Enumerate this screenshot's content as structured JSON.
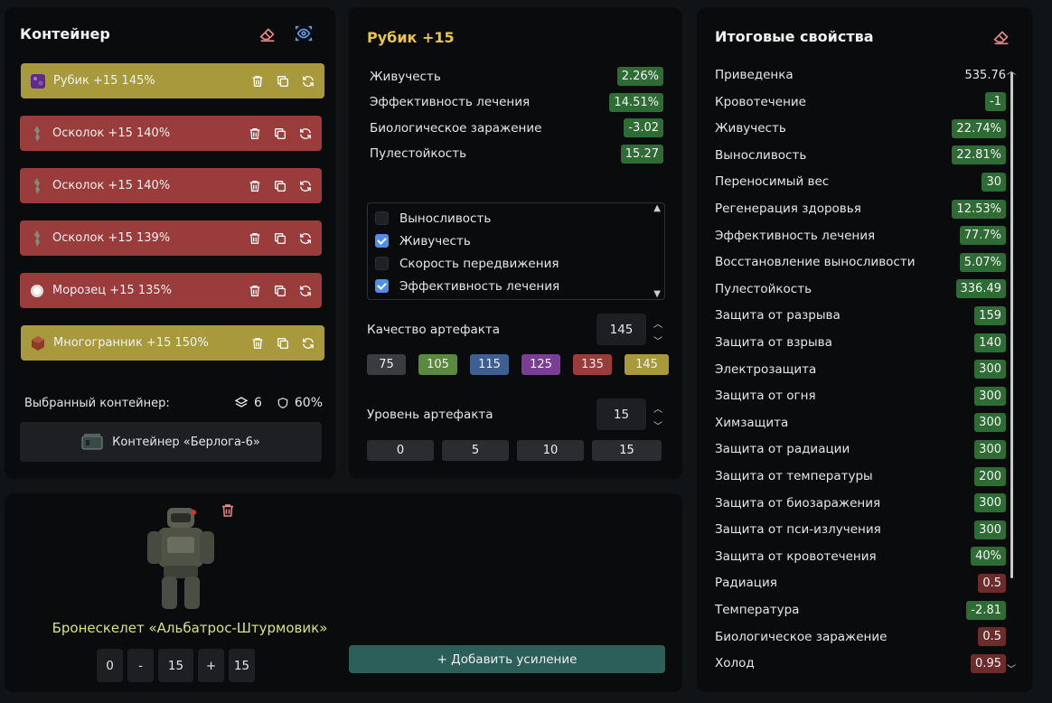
{
  "container_panel": {
    "title": "Контейнер",
    "items": [
      {
        "label": "Рубик +15 145%",
        "color": "gold",
        "icon": "rubik-artifact-icon",
        "third_icon": "refresh-icon"
      },
      {
        "label": "Осколок +15 140%",
        "color": "red",
        "icon": "shard-artifact-icon"
      },
      {
        "label": "Осколок +15 140%",
        "color": "red",
        "icon": "shard-artifact-icon"
      },
      {
        "label": "Осколок +15 139%",
        "color": "red",
        "icon": "shard-artifact-icon"
      },
      {
        "label": "Морозец +15 135%",
        "color": "red",
        "icon": "frost-artifact-icon"
      },
      {
        "label": "Многогранник +15 150%",
        "color": "gold",
        "icon": "polyhedron-artifact-icon"
      }
    ],
    "selected_label": "Выбранный контейнер:",
    "slots": "6",
    "protection": "60%",
    "container_name": "Контейнер «Берлога-6»"
  },
  "artifact_panel": {
    "title": "Рубик +15",
    "stats": [
      {
        "name": "Живучесть",
        "value": "2.26%",
        "tone": "g"
      },
      {
        "name": "Эффективность лечения",
        "value": "14.51%",
        "tone": "g"
      },
      {
        "name": "Биологическое заражение",
        "value": "-3.02",
        "tone": "g"
      },
      {
        "name": "Пулестойкость",
        "value": "15.27",
        "tone": "g"
      }
    ],
    "checklist": [
      {
        "label": "Выносливость",
        "checked": false
      },
      {
        "label": "Живучесть",
        "checked": true
      },
      {
        "label": "Скорость передвижения",
        "checked": false
      },
      {
        "label": "Эффективность лечения",
        "checked": true
      }
    ],
    "quality_label": "Качество артефакта",
    "quality_value": "145",
    "quality_options": [
      {
        "label": "75",
        "color": "#3a3c40"
      },
      {
        "label": "105",
        "color": "#5a8a3e"
      },
      {
        "label": "115",
        "color": "#3f5f92"
      },
      {
        "label": "125",
        "color": "#7a3e94"
      },
      {
        "label": "135",
        "color": "#9a3b3c"
      },
      {
        "label": "145",
        "color": "#a89a3c"
      }
    ],
    "level_label": "Уровень артефакта",
    "level_value": "15",
    "level_options": [
      "0",
      "5",
      "10",
      "15"
    ]
  },
  "total_panel": {
    "title": "Итоговые свойства",
    "rows": [
      {
        "name": "Приведенка",
        "value": "535.76",
        "tone": "none"
      },
      {
        "name": "Кровотечение",
        "value": "-1",
        "tone": "g"
      },
      {
        "name": "Живучесть",
        "value": "22.74%",
        "tone": "g"
      },
      {
        "name": "Выносливость",
        "value": "22.81%",
        "tone": "g"
      },
      {
        "name": "Переносимый вес",
        "value": "30",
        "tone": "g"
      },
      {
        "name": "Регенерация здоровья",
        "value": "12.53%",
        "tone": "g"
      },
      {
        "name": "Эффективность лечения",
        "value": "77.7%",
        "tone": "g"
      },
      {
        "name": "Восстановление выносливости",
        "value": "5.07%",
        "tone": "g"
      },
      {
        "name": "Пулестойкость",
        "value": "336.49",
        "tone": "g"
      },
      {
        "name": "Защита от разрыва",
        "value": "159",
        "tone": "g"
      },
      {
        "name": "Защита от взрыва",
        "value": "140",
        "tone": "g"
      },
      {
        "name": "Электрозащита",
        "value": "300",
        "tone": "g"
      },
      {
        "name": "Защита от огня",
        "value": "300",
        "tone": "g"
      },
      {
        "name": "Химзащита",
        "value": "300",
        "tone": "g"
      },
      {
        "name": "Защита от радиации",
        "value": "300",
        "tone": "g"
      },
      {
        "name": "Защита от температуры",
        "value": "200",
        "tone": "g"
      },
      {
        "name": "Защита от биозаражения",
        "value": "300",
        "tone": "g"
      },
      {
        "name": "Защита от пси-излучения",
        "value": "300",
        "tone": "g"
      },
      {
        "name": "Защита от кровотечения",
        "value": "40%",
        "tone": "g"
      },
      {
        "name": "Радиация",
        "value": "0.5",
        "tone": "r"
      },
      {
        "name": "Температура",
        "value": "-2.81",
        "tone": "g"
      },
      {
        "name": "Биологическое заражение",
        "value": "0.5",
        "tone": "r"
      },
      {
        "name": "Холод",
        "value": "0.95",
        "tone": "r"
      }
    ]
  },
  "armor_panel": {
    "name": "Бронескелет «Альбатрос-Штурмовик»",
    "level_min": "0",
    "minus": "-",
    "level": "15",
    "plus": "+",
    "level_max": "15",
    "add_label": "+ Добавить усиление"
  }
}
